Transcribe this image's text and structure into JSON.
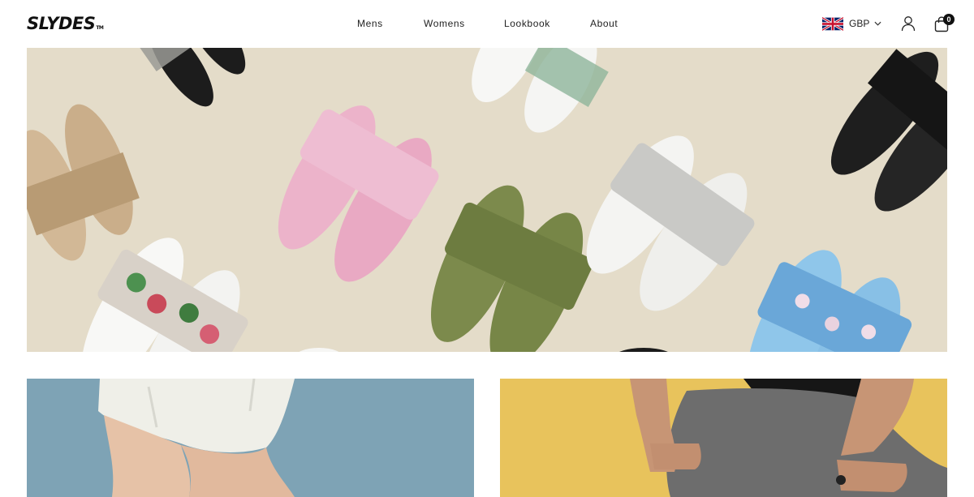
{
  "brand": {
    "logo_text": "SLYDES",
    "logo_mark": "TM"
  },
  "nav": {
    "items": [
      {
        "label": "Mens"
      },
      {
        "label": "Womens"
      },
      {
        "label": "Lookbook"
      },
      {
        "label": "About"
      }
    ]
  },
  "currency": {
    "selected": "GBP",
    "flag_icon": "uk-flag-icon"
  },
  "account": {
    "icon": "user-icon"
  },
  "cart": {
    "icon": "shopping-bag-icon",
    "count": "0"
  },
  "hero": {
    "image": "sliders-flatlay-banner"
  },
  "tiles": [
    {
      "image": "woman-legs-denim-shorts-blue-background"
    },
    {
      "image": "man-tattooed-hands-yellow-background"
    }
  ],
  "colors": {
    "hero_background": "#e4dcc9",
    "tile_left_background": "#7ea3b5",
    "tile_right_background": "#e8c35c",
    "text": "#111111"
  }
}
